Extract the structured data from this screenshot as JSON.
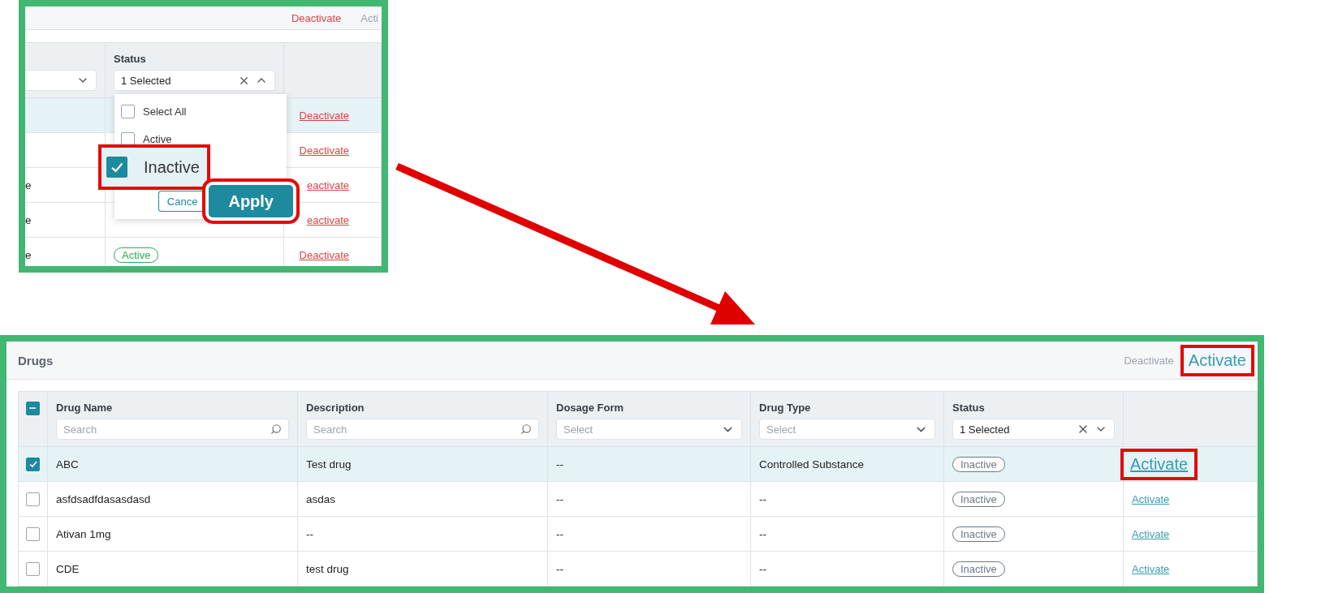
{
  "before": {
    "header_actions": [
      {
        "label": "Deactivate",
        "kind": "deactivate",
        "enabled": true,
        "highlighted": false
      },
      {
        "label": "Acti",
        "kind": "activate",
        "enabled": false,
        "highlighted": false
      }
    ],
    "status_column": {
      "label": "Status",
      "value": "1 Selected",
      "expanded": true
    },
    "rows": [
      {
        "selected": true,
        "action": {
          "label": "Deactivate",
          "kind": "deactivate",
          "highlighted": false
        }
      },
      {
        "selected": false,
        "action": {
          "label": "Deactivate",
          "kind": "deactivate",
          "highlighted": false
        }
      },
      {
        "selected": false,
        "column_1": "e",
        "action": {
          "label": "eactivate",
          "kind": "deactivate",
          "highlighted": false
        }
      },
      {
        "selected": false,
        "column_1": "e",
        "action": {
          "label": "eactivate",
          "kind": "deactivate",
          "highlighted": false
        }
      },
      {
        "selected": false,
        "column_1": "e",
        "status": {
          "label": "Active",
          "kind": "active"
        },
        "action": {
          "label": "Deactivate",
          "kind": "deactivate",
          "highlighted": false
        }
      }
    ],
    "dropdown": {
      "items": [
        {
          "label": "Select All",
          "checked": false,
          "highlighted": false
        },
        {
          "label": "Active",
          "checked": false,
          "highlighted": false
        },
        {
          "label": "Inactive",
          "checked": true,
          "highlighted": true
        }
      ],
      "buttons": [
        {
          "label": "Cance",
          "kind": "secondary",
          "highlighted": false
        },
        {
          "label": "Apply",
          "kind": "primary",
          "highlighted": true
        }
      ]
    }
  },
  "after": {
    "title": "Drugs",
    "header_actions": [
      {
        "label": "Deactivate",
        "kind": "deactivate",
        "enabled": false,
        "highlighted": false
      },
      {
        "label": "Activate",
        "kind": "activate",
        "enabled": true,
        "highlighted": true
      }
    ],
    "select_all": {
      "indeterminate": true
    },
    "columns": [
      {
        "label": "Drug Name",
        "filter": {
          "kind": "search",
          "placeholder": "Search"
        }
      },
      {
        "label": "Description",
        "filter": {
          "kind": "search",
          "placeholder": "Search"
        }
      },
      {
        "label": "Dosage Form",
        "filter": {
          "kind": "select",
          "placeholder": "Select"
        }
      },
      {
        "label": "Drug Type",
        "filter": {
          "kind": "select",
          "placeholder": "Select"
        }
      },
      {
        "label": "Status",
        "filter": {
          "kind": "multiselect",
          "value": "1 Selected",
          "expanded": false
        }
      }
    ],
    "rows": [
      {
        "selected": true,
        "cells": [
          "ABC",
          "Test drug",
          "--",
          "Controlled Substance"
        ],
        "status": {
          "label": "Inactive",
          "kind": "inactive"
        },
        "action": {
          "label": "Activate",
          "kind": "activate",
          "highlighted": true
        }
      },
      {
        "selected": false,
        "cells": [
          "asfdsadfdasasdasd",
          "asdas",
          "--",
          "--"
        ],
        "status": {
          "label": "Inactive",
          "kind": "inactive"
        },
        "action": {
          "label": "Activate",
          "kind": "activate",
          "highlighted": false
        }
      },
      {
        "selected": false,
        "cells": [
          "Ativan 1mg",
          "--",
          "--",
          "--"
        ],
        "status": {
          "label": "Inactive",
          "kind": "inactive"
        },
        "action": {
          "label": "Activate",
          "kind": "activate",
          "highlighted": false
        }
      },
      {
        "selected": false,
        "cells": [
          "CDE",
          "test drug",
          "--",
          "--"
        ],
        "status": {
          "label": "Inactive",
          "kind": "inactive"
        },
        "action": {
          "label": "Activate",
          "kind": "activate",
          "highlighted": false
        }
      }
    ]
  }
}
